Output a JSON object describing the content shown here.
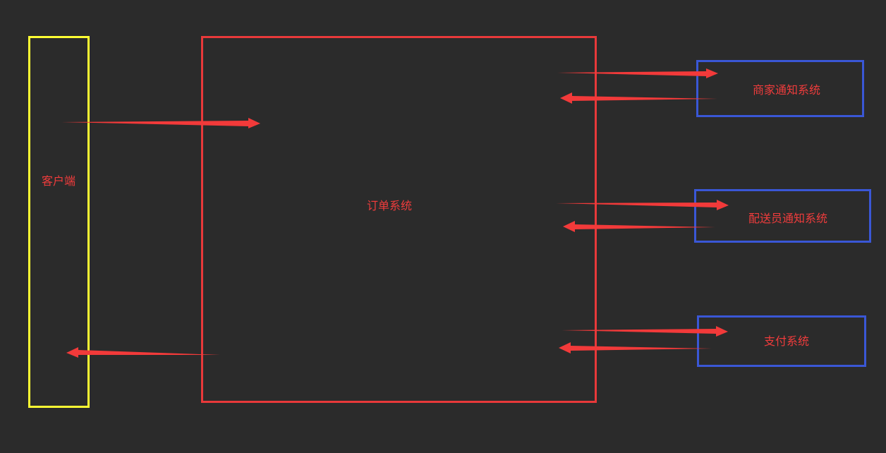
{
  "diagram": {
    "background_color": "#2b2b2b",
    "arrow_color": "#f23a3a",
    "nodes": [
      {
        "id": "client",
        "label": "客户端",
        "border_color": "#ffff33"
      },
      {
        "id": "order",
        "label": "订单系统",
        "border_color": "#e8393a"
      },
      {
        "id": "merchant",
        "label": "商家通知系统",
        "border_color": "#3a57d6"
      },
      {
        "id": "courier",
        "label": "配送员通知系统",
        "border_color": "#3a57d6"
      },
      {
        "id": "payment",
        "label": "支付系统",
        "border_color": "#3a57d6"
      }
    ],
    "edges": [
      {
        "from": "client",
        "to": "order"
      },
      {
        "from": "order",
        "to": "client"
      },
      {
        "from": "order",
        "to": "merchant"
      },
      {
        "from": "merchant",
        "to": "order"
      },
      {
        "from": "order",
        "to": "courier"
      },
      {
        "from": "courier",
        "to": "order"
      },
      {
        "from": "order",
        "to": "payment"
      },
      {
        "from": "payment",
        "to": "order"
      }
    ]
  }
}
